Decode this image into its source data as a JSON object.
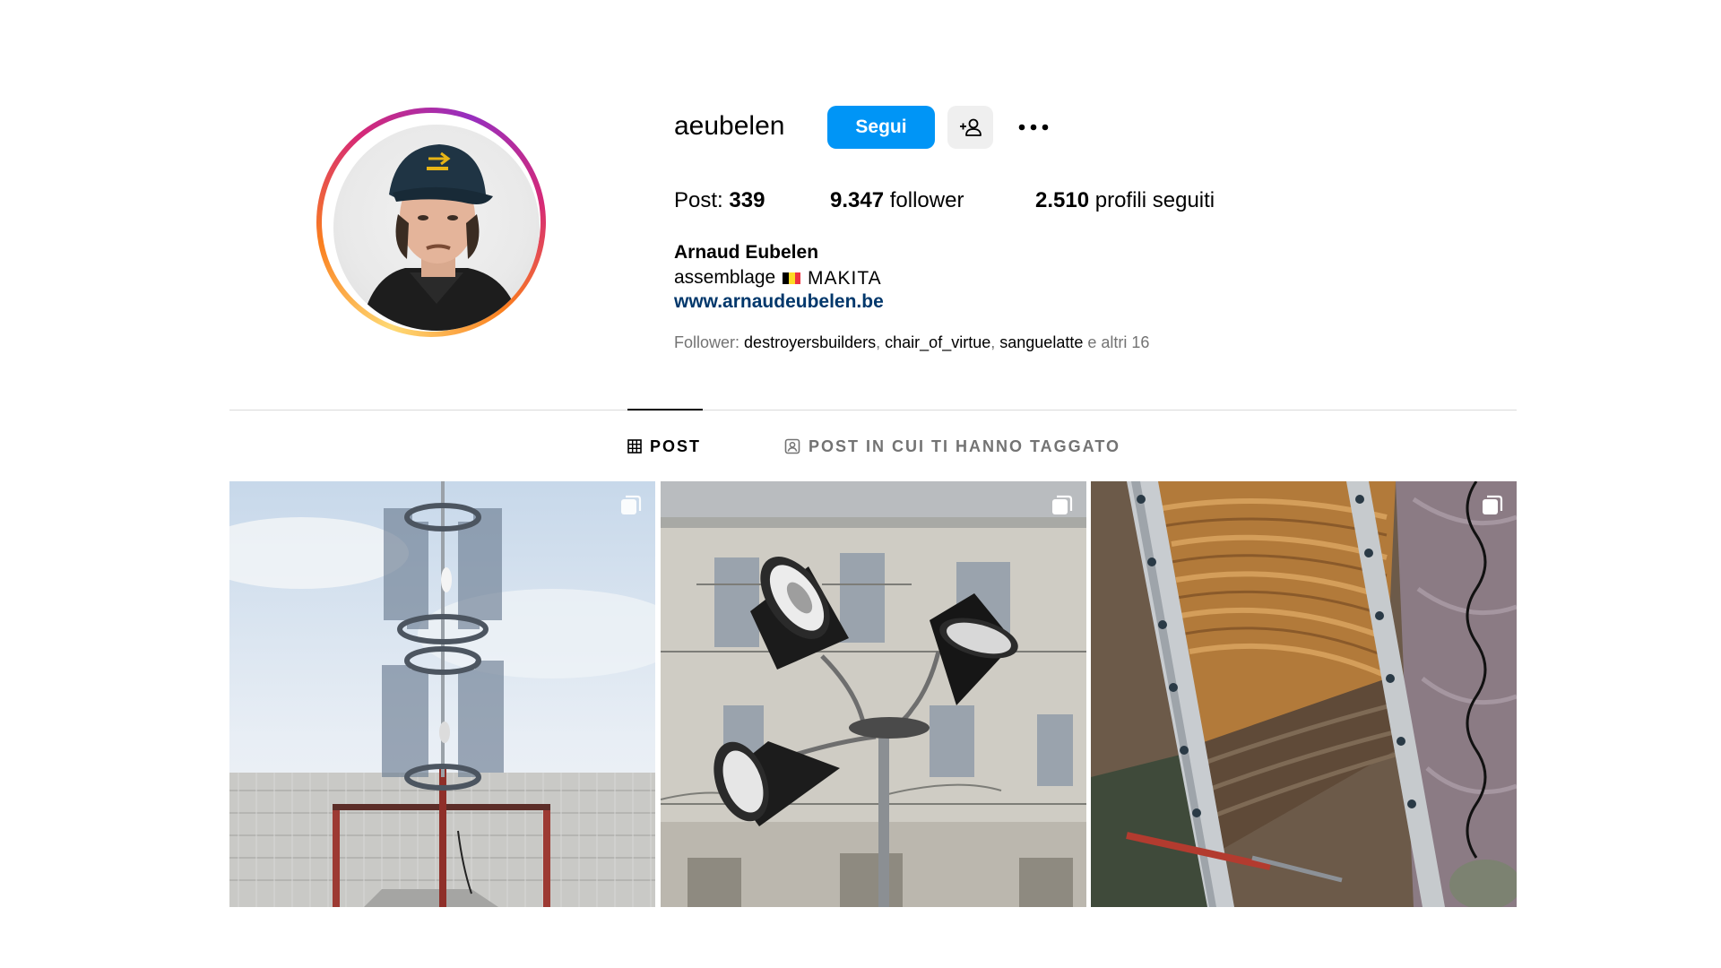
{
  "profile": {
    "username": "aeubelen",
    "follow_label": "Segui",
    "suggest_icon": "person-add-icon",
    "more_icon": "more-horizontal-icon",
    "stats": {
      "posts_label": "Post:",
      "posts_count": "339",
      "followers_count": "9.347",
      "followers_label": "follower",
      "following_count": "2.510",
      "following_label": "profili seguiti"
    },
    "full_name": "Arnaud Eubelen",
    "bio_text": "assemblage",
    "bio_flag": "Belgium flag",
    "bio_brand": "MAKITA",
    "website": "www.arnaudeubelen.be",
    "followed_by": {
      "label": "Follower:",
      "names": [
        "destroyersbuilders",
        "chair_of_virtue",
        "sanguelatte"
      ],
      "separator": ",",
      "more": "e altri 16"
    }
  },
  "tabs": [
    {
      "label": "POST",
      "icon": "grid-icon",
      "active": true
    },
    {
      "label": "POST IN CUI TI HANNO TAGGATO",
      "icon": "tagged-icon",
      "active": false
    }
  ],
  "posts": [
    {
      "description": "wind turbine sculpture",
      "multiple": true
    },
    {
      "description": "loudspeaker lamps sculpture",
      "multiple": true
    },
    {
      "description": "cushions and aluminum rails",
      "multiple": true
    }
  ],
  "colors": {
    "follow_button": "#0095f6",
    "link": "#00376b",
    "secondary_text": "#737373",
    "divider": "#dbdbdb"
  }
}
